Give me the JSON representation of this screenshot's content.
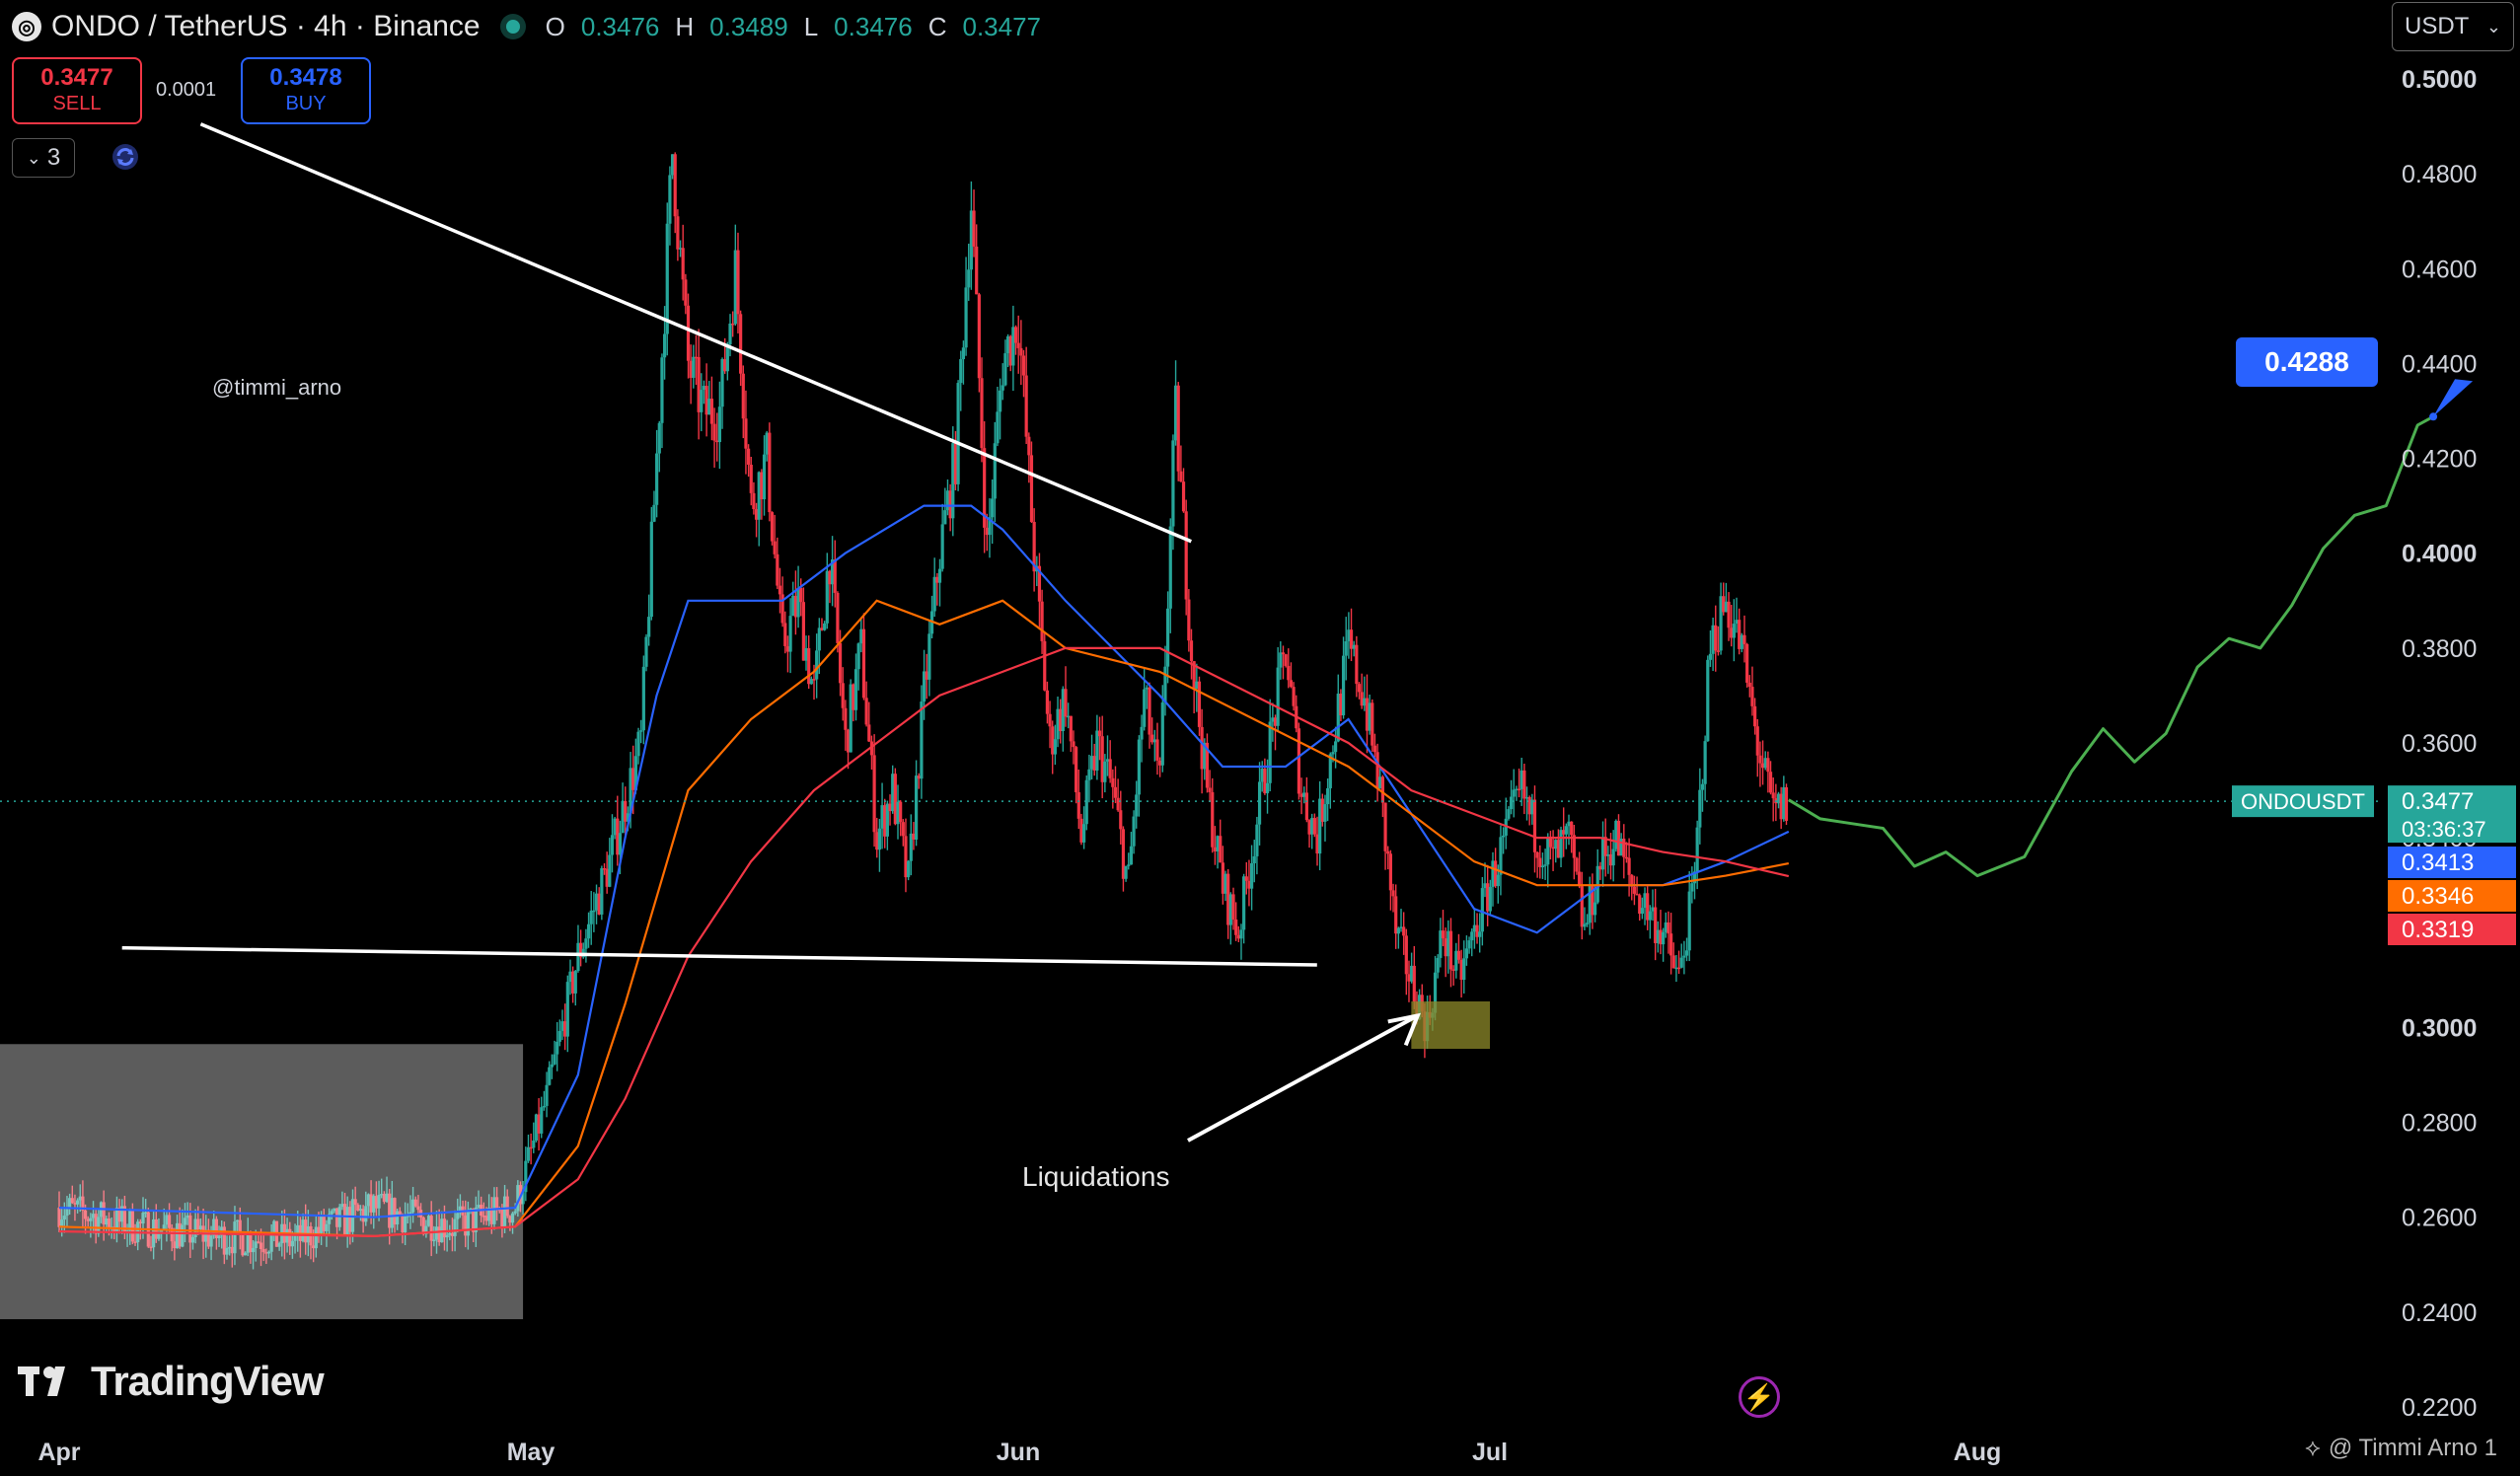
{
  "header": {
    "title": "ONDO / TetherUS · 4h · Binance",
    "ohlc": [
      {
        "k": "O",
        "v": "0.3476"
      },
      {
        "k": "H",
        "v": "0.3489"
      },
      {
        "k": "L",
        "v": "0.3476"
      },
      {
        "k": "C",
        "v": "0.3477"
      }
    ]
  },
  "trade": {
    "sell_price": "0.3477",
    "sell_label": "SELL",
    "spread": "0.0001",
    "buy_price": "0.3478",
    "buy_label": "BUY",
    "interval_count": "3"
  },
  "currency": "USDT",
  "watermark": "@timmi_arno",
  "brand": "TradingView",
  "credit": "@ Timmi Arno 1",
  "colors": {
    "up": "#26a69a",
    "down": "#f23645",
    "ma_blue": "#2962ff",
    "ma_orange": "#ff6d00",
    "ma_red": "#f23645",
    "projection": "#4caf50",
    "target": "#2962ff"
  },
  "chart_data": {
    "type": "candlestick",
    "symbol": "ONDOUSDT",
    "timeframe": "4h",
    "y_range": [
      0.215,
      0.505
    ],
    "y_ticks": [
      "0.5000",
      "0.4800",
      "0.4600",
      "0.4400",
      "0.4200",
      "0.4000",
      "0.3800",
      "0.3600",
      "0.3400",
      "0.3200",
      "0.3000",
      "0.2800",
      "0.2600",
      "0.2400",
      "0.2200"
    ],
    "x_ticks": [
      {
        "label": "Apr",
        "day": 0
      },
      {
        "label": "May",
        "day": 30
      },
      {
        "label": "Jun",
        "day": 61
      },
      {
        "label": "Jul",
        "day": 91
      },
      {
        "label": "Aug",
        "day": 122
      }
    ],
    "price_path": [
      [
        0,
        0.262
      ],
      [
        5,
        0.258
      ],
      [
        10,
        0.256
      ],
      [
        15,
        0.255
      ],
      [
        20,
        0.262
      ],
      [
        25,
        0.258
      ],
      [
        29,
        0.262
      ],
      [
        31,
        0.285
      ],
      [
        33,
        0.315
      ],
      [
        35,
        0.335
      ],
      [
        37,
        0.36
      ],
      [
        38,
        0.42
      ],
      [
        39,
        0.485
      ],
      [
        40,
        0.44
      ],
      [
        41,
        0.43
      ],
      [
        42,
        0.43
      ],
      [
        43,
        0.46
      ],
      [
        44,
        0.41
      ],
      [
        45,
        0.42
      ],
      [
        46,
        0.38
      ],
      [
        47,
        0.39
      ],
      [
        48,
        0.37
      ],
      [
        49,
        0.4
      ],
      [
        50,
        0.36
      ],
      [
        51,
        0.38
      ],
      [
        52,
        0.34
      ],
      [
        53,
        0.35
      ],
      [
        54,
        0.33
      ],
      [
        55,
        0.37
      ],
      [
        56,
        0.4
      ],
      [
        57,
        0.42
      ],
      [
        58,
        0.475
      ],
      [
        59,
        0.4
      ],
      [
        60,
        0.44
      ],
      [
        61,
        0.45
      ],
      [
        62,
        0.4
      ],
      [
        63,
        0.36
      ],
      [
        64,
        0.37
      ],
      [
        65,
        0.34
      ],
      [
        66,
        0.36
      ],
      [
        67,
        0.35
      ],
      [
        68,
        0.33
      ],
      [
        69,
        0.37
      ],
      [
        70,
        0.35
      ],
      [
        71,
        0.43
      ],
      [
        72,
        0.38
      ],
      [
        73,
        0.35
      ],
      [
        74,
        0.33
      ],
      [
        75,
        0.32
      ],
      [
        76,
        0.34
      ],
      [
        77,
        0.36
      ],
      [
        78,
        0.38
      ],
      [
        79,
        0.35
      ],
      [
        80,
        0.34
      ],
      [
        81,
        0.36
      ],
      [
        82,
        0.38
      ],
      [
        83,
        0.37
      ],
      [
        84,
        0.35
      ],
      [
        85,
        0.32
      ],
      [
        86,
        0.31
      ],
      [
        87,
        0.3
      ],
      [
        88,
        0.32
      ],
      [
        89,
        0.31
      ],
      [
        90,
        0.32
      ],
      [
        91,
        0.33
      ],
      [
        92,
        0.34
      ],
      [
        93,
        0.35
      ],
      [
        94,
        0.34
      ],
      [
        95,
        0.335
      ],
      [
        96,
        0.34
      ],
      [
        97,
        0.32
      ],
      [
        98,
        0.335
      ],
      [
        99,
        0.34
      ],
      [
        100,
        0.33
      ],
      [
        101,
        0.325
      ],
      [
        102,
        0.32
      ],
      [
        103,
        0.31
      ],
      [
        104,
        0.33
      ],
      [
        105,
        0.38
      ],
      [
        106,
        0.39
      ],
      [
        107,
        0.38
      ],
      [
        108,
        0.36
      ],
      [
        109,
        0.345
      ],
      [
        110,
        0.3477
      ]
    ],
    "ma_blue": [
      [
        0,
        0.262
      ],
      [
        20,
        0.26
      ],
      [
        29,
        0.262
      ],
      [
        33,
        0.29
      ],
      [
        36,
        0.34
      ],
      [
        38,
        0.37
      ],
      [
        40,
        0.39
      ],
      [
        42,
        0.39
      ],
      [
        46,
        0.39
      ],
      [
        50,
        0.4
      ],
      [
        55,
        0.41
      ],
      [
        58,
        0.41
      ],
      [
        60,
        0.405
      ],
      [
        64,
        0.39
      ],
      [
        70,
        0.37
      ],
      [
        74,
        0.355
      ],
      [
        78,
        0.355
      ],
      [
        82,
        0.365
      ],
      [
        86,
        0.345
      ],
      [
        90,
        0.325
      ],
      [
        94,
        0.32
      ],
      [
        98,
        0.33
      ],
      [
        102,
        0.33
      ],
      [
        106,
        0.335
      ],
      [
        110,
        0.3413
      ]
    ],
    "ma_orange": [
      [
        0,
        0.258
      ],
      [
        20,
        0.256
      ],
      [
        29,
        0.258
      ],
      [
        33,
        0.275
      ],
      [
        36,
        0.305
      ],
      [
        40,
        0.35
      ],
      [
        44,
        0.365
      ],
      [
        48,
        0.375
      ],
      [
        52,
        0.39
      ],
      [
        56,
        0.385
      ],
      [
        60,
        0.39
      ],
      [
        64,
        0.38
      ],
      [
        70,
        0.375
      ],
      [
        76,
        0.365
      ],
      [
        82,
        0.355
      ],
      [
        86,
        0.345
      ],
      [
        90,
        0.335
      ],
      [
        94,
        0.33
      ],
      [
        98,
        0.33
      ],
      [
        102,
        0.33
      ],
      [
        106,
        0.332
      ],
      [
        110,
        0.3346
      ]
    ],
    "ma_red": [
      [
        0,
        0.257
      ],
      [
        20,
        0.256
      ],
      [
        29,
        0.258
      ],
      [
        33,
        0.268
      ],
      [
        36,
        0.285
      ],
      [
        40,
        0.315
      ],
      [
        44,
        0.335
      ],
      [
        48,
        0.35
      ],
      [
        52,
        0.36
      ],
      [
        56,
        0.37
      ],
      [
        60,
        0.375
      ],
      [
        64,
        0.38
      ],
      [
        70,
        0.38
      ],
      [
        76,
        0.37
      ],
      [
        82,
        0.36
      ],
      [
        86,
        0.35
      ],
      [
        90,
        0.345
      ],
      [
        94,
        0.34
      ],
      [
        98,
        0.34
      ],
      [
        102,
        0.337
      ],
      [
        106,
        0.335
      ],
      [
        110,
        0.3319
      ]
    ],
    "trendline_upper": [
      [
        9,
        0.4905
      ],
      [
        72,
        0.4025
      ]
    ],
    "trendline_lower": [
      [
        4,
        0.3168
      ],
      [
        80,
        0.3132
      ]
    ],
    "projection": [
      [
        110,
        0.348
      ],
      [
        112,
        0.344
      ],
      [
        114,
        0.343
      ],
      [
        116,
        0.342
      ],
      [
        118,
        0.334
      ],
      [
        120,
        0.337
      ],
      [
        122,
        0.332
      ],
      [
        125,
        0.336
      ],
      [
        128,
        0.354
      ],
      [
        130,
        0.363
      ],
      [
        132,
        0.356
      ],
      [
        134,
        0.362
      ],
      [
        136,
        0.376
      ],
      [
        138,
        0.382
      ],
      [
        140,
        0.38
      ],
      [
        142,
        0.389
      ],
      [
        144,
        0.401
      ],
      [
        146,
        0.408
      ],
      [
        148,
        0.41
      ],
      [
        150,
        0.427
      ],
      [
        151,
        0.4288
      ]
    ],
    "liquidation_zone": {
      "day_start": 86,
      "day_end": 91,
      "price_low": 0.2955,
      "price_high": 0.3055
    },
    "annotation": "Liquidations",
    "target_label": "0.4288",
    "current_price": {
      "value": 0.3477,
      "label": "0.3477",
      "countdown": "03:36:37",
      "symbol": "ONDOUSDT"
    },
    "ma_labels": [
      {
        "value": 0.3413,
        "label": "0.3413",
        "color": "#2962ff"
      },
      {
        "value": 0.3346,
        "label": "0.3346",
        "color": "#ff6d00"
      },
      {
        "value": 0.3319,
        "label": "0.3319",
        "color": "#f23645"
      }
    ]
  }
}
